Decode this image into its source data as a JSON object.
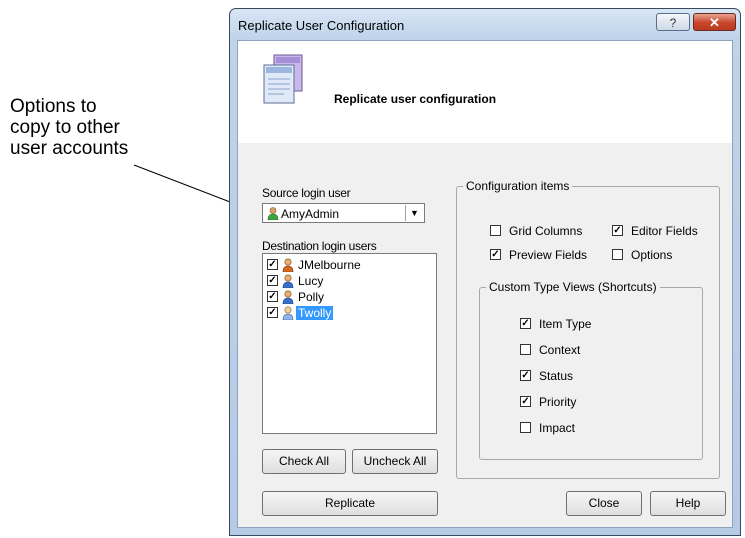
{
  "annotation": {
    "text": "Options to copy to other user accounts"
  },
  "window": {
    "title": "Replicate User Configuration",
    "help_glyph": "?",
    "close_glyph": "✕"
  },
  "header": {
    "title": "Replicate user configuration"
  },
  "source": {
    "label": "Source login user",
    "selected": "AmyAdmin"
  },
  "destination": {
    "label": "Destination login users",
    "users": [
      {
        "name": "JMelbourne",
        "checked": true
      },
      {
        "name": "Lucy",
        "checked": true
      },
      {
        "name": "Polly",
        "checked": true
      },
      {
        "name": "Twolly",
        "checked": true,
        "selected": true
      }
    ]
  },
  "buttons": {
    "check_all": "Check All",
    "uncheck_all": "Uncheck All",
    "replicate": "Replicate",
    "close": "Close",
    "help": "Help"
  },
  "config": {
    "title": "Configuration items",
    "grid_columns": {
      "label": "Grid Columns",
      "checked": false
    },
    "editor_fields": {
      "label": "Editor Fields",
      "checked": true
    },
    "preview_fields": {
      "label": "Preview Fields",
      "checked": true
    },
    "options": {
      "label": "Options",
      "checked": false
    }
  },
  "custom_views": {
    "title": "Custom Type Views (Shortcuts)",
    "item_type": {
      "label": "Item Type",
      "checked": true
    },
    "context": {
      "label": "Context",
      "checked": false
    },
    "status": {
      "label": "Status",
      "checked": true
    },
    "priority": {
      "label": "Priority",
      "checked": true
    },
    "impact": {
      "label": "Impact",
      "checked": false
    }
  },
  "colors": {
    "selection": "#3399ff",
    "close_button": "#c7452a",
    "dialog_bg": "#f0f0f0"
  }
}
